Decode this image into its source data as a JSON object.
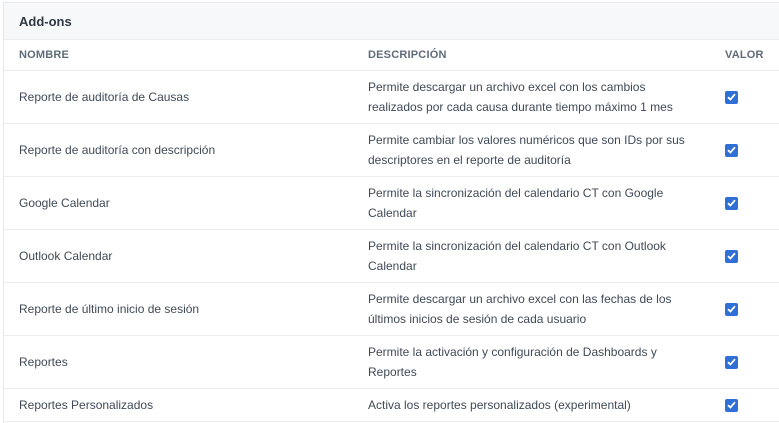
{
  "panel": {
    "title": "Add-ons"
  },
  "columns": {
    "name": "NOMBRE",
    "description": "DESCRIPCIÓN",
    "value": "VALOR"
  },
  "accent_color": "#2f6fd6",
  "rows": [
    {
      "name": "Reporte de auditoría de Causas",
      "description": "Permite descargar un archivo excel con los cambios realizados por cada causa durante tiempo máximo 1 mes",
      "checked": true
    },
    {
      "name": "Reporte de auditoría con descripción",
      "description": "Permite cambiar los valores numéricos que son IDs por sus descriptores en el reporte de auditoría",
      "checked": true
    },
    {
      "name": "Google Calendar",
      "description": "Permite la sincronización del calendario CT con Google Calendar",
      "checked": true
    },
    {
      "name": "Outlook Calendar",
      "description": "Permite la sincronización del calendario CT con Outlook Calendar",
      "checked": true
    },
    {
      "name": "Reporte de último inicio de sesión",
      "description": "Permite descargar un archivo excel con las fechas de los últimos inicios de sesión de cada usuario",
      "checked": true
    },
    {
      "name": "Reportes",
      "description": "Permite la activación y configuración de Dashboards y Reportes",
      "checked": true
    },
    {
      "name": "Reportes Personalizados",
      "description": "Activa los reportes personalizados (experimental)",
      "checked": true
    }
  ]
}
